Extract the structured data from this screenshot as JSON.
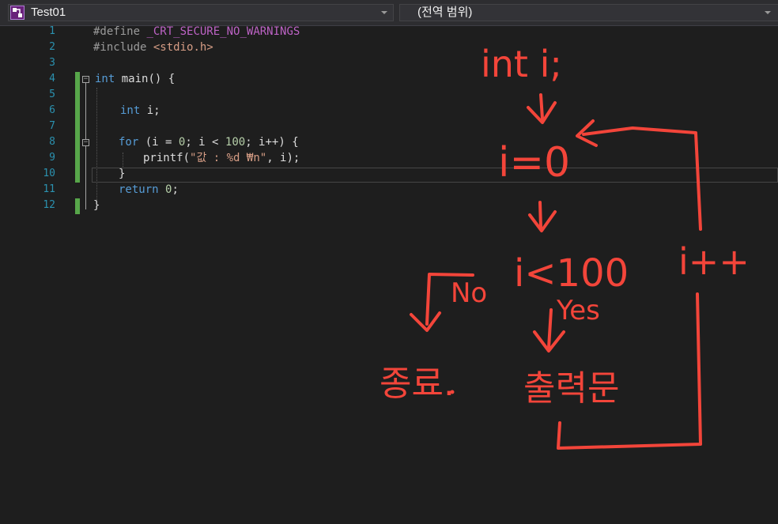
{
  "navbar": {
    "project": "Test01",
    "scope": "(전역 범위)"
  },
  "editor": {
    "line_numbers": [
      "1",
      "2",
      "3",
      "4",
      "5",
      "6",
      "7",
      "8",
      "9",
      "10",
      "11",
      "12"
    ],
    "lines": {
      "l1_directive": "#define",
      "l1_macro": "_CRT_SECURE_NO_WARNINGS",
      "l2_directive": "#include",
      "l2_header": "<stdio.h>",
      "l4_type": "int",
      "l4_rest": " main() {",
      "l6_type": "int",
      "l6_rest": " i;",
      "l8_kw": "for",
      "l8_a": " (i = ",
      "l8_n1": "0",
      "l8_b": "; i < ",
      "l8_n2": "100",
      "l8_c": "; i++) {",
      "l9_fn": "printf(",
      "l9_str": "\"값 : %d ₩n\"",
      "l9_rest": ", i);",
      "l10": "}",
      "l11_kw": "return",
      "l11_sp": " ",
      "l11_num": "0",
      "l11_end": ";",
      "l12": "}"
    }
  },
  "annotations": {
    "decl": "int i;",
    "init": "i=0",
    "cond": "i<100",
    "no": "No",
    "yes": "Yes",
    "end": "종료.",
    "print": "출력문",
    "inc": "i++"
  },
  "colors": {
    "annotation": "#f3453a",
    "line_number": "#2b91af",
    "keyword": "#569cd6",
    "string": "#d69d85",
    "change_bar": "#57a64a"
  }
}
